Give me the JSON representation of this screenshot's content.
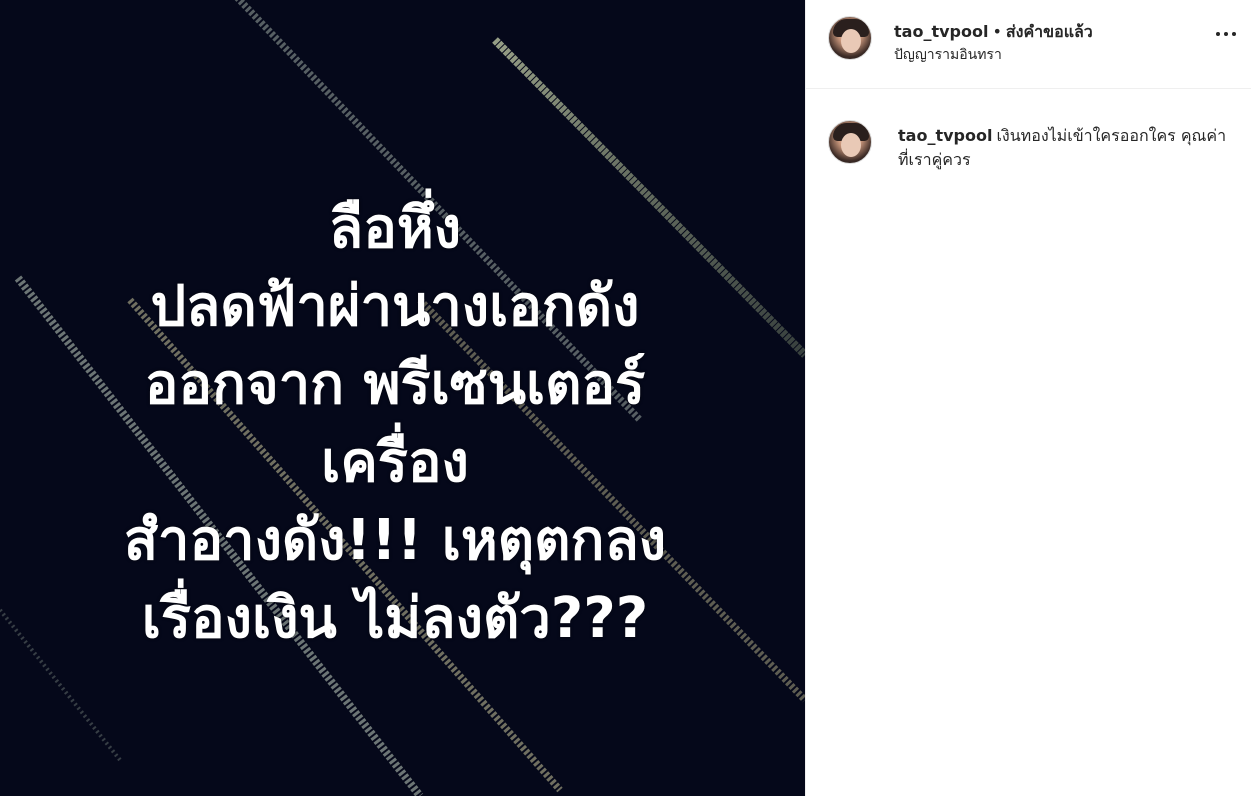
{
  "media": {
    "headline_lines": [
      "ลือหึ่ง",
      "ปลดฟ้าผ่านางเอกดัง",
      "ออกจาก พรีเซนเตอร์",
      "เครื่อง",
      "สำอางดัง!!! เหตุตกลง",
      "เรื่องเงิน ไม่ลงตัว???"
    ],
    "background_color": "#05081a"
  },
  "header": {
    "username": "tao_tvpool",
    "separator": "•",
    "follow_status": "ส่งคำขอแล้ว",
    "location": "ปัญญารามอินทรา",
    "more_icon": "more-options-icon"
  },
  "comment": {
    "username": "tao_tvpool",
    "text": "เงินทองไม่เข้าใครออกใคร คุณค่าที่เราคู่ควร"
  },
  "colors": {
    "text": "#262626",
    "border": "#efefef"
  }
}
